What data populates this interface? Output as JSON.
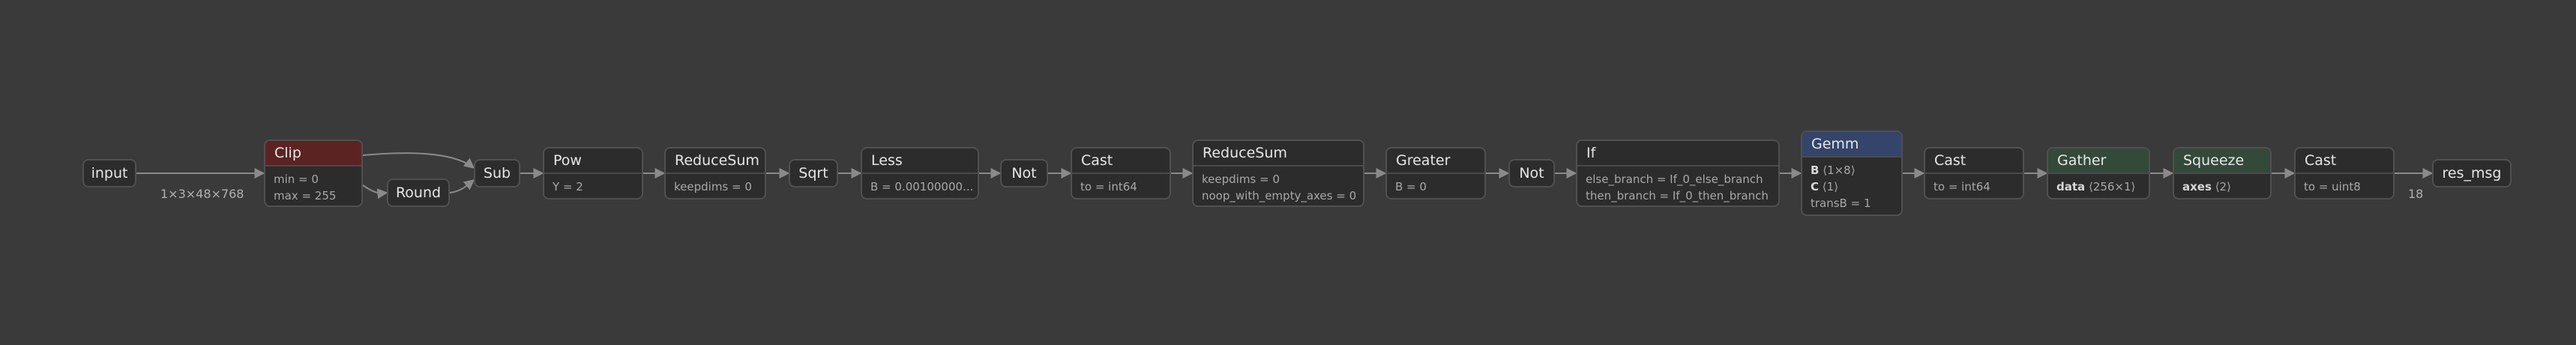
{
  "graph": {
    "nodes": {
      "input": {
        "label": "input"
      },
      "clip": {
        "label": "Clip",
        "attrs": {
          "a0": "min = 0",
          "a1": "max = 255"
        }
      },
      "round": {
        "label": "Round"
      },
      "sub": {
        "label": "Sub"
      },
      "pow": {
        "label": "Pow",
        "attrs": {
          "a0": "Y = 2"
        }
      },
      "reducesum1": {
        "label": "ReduceSum",
        "attrs": {
          "a0": "keepdims = 0"
        }
      },
      "sqrt": {
        "label": "Sqrt"
      },
      "less": {
        "label": "Less",
        "attrs": {
          "a0": "B = 0.00100000..."
        }
      },
      "not1": {
        "label": "Not"
      },
      "cast1": {
        "label": "Cast",
        "attrs": {
          "a0": "to = int64"
        }
      },
      "reducesum2": {
        "label": "ReduceSum",
        "attrs": {
          "a0": "keepdims = 0",
          "a1": "noop_with_empty_axes = 0"
        }
      },
      "greater": {
        "label": "Greater",
        "attrs": {
          "a0": "B = 0"
        }
      },
      "not2": {
        "label": "Not"
      },
      "if": {
        "label": "If",
        "attrs": {
          "a0": "else_branch = If_0_else_branch",
          "a1": "then_branch = If_0_then_branch"
        }
      },
      "gemm": {
        "label": "Gemm",
        "attrs": {
          "a0k": "B",
          "a0v": "⟨1×8⟩",
          "a1k": "C",
          "a1v": "⟨1⟩",
          "a2": "transB = 1"
        }
      },
      "cast2": {
        "label": "Cast",
        "attrs": {
          "a0": "to = int64"
        }
      },
      "gather": {
        "label": "Gather",
        "attrs": {
          "a0k": "data",
          "a0v": "⟨256×1⟩"
        }
      },
      "squeeze": {
        "label": "Squeeze",
        "attrs": {
          "a0k": "axes",
          "a0v": "⟨2⟩"
        }
      },
      "cast3": {
        "label": "Cast",
        "attrs": {
          "a0": "to = uint8"
        }
      },
      "res_msg": {
        "label": "res_msg"
      }
    },
    "edge_labels": {
      "input_clip": "1×3×48×768",
      "cast3_res": "18"
    },
    "colors": {
      "background": "#3a3a3a",
      "node_fill": "#2c2c2c",
      "clip_header": "#5c2323",
      "gemm_header": "#34446a",
      "gather_header": "#33493a",
      "edge": "#8a8a8a"
    }
  }
}
